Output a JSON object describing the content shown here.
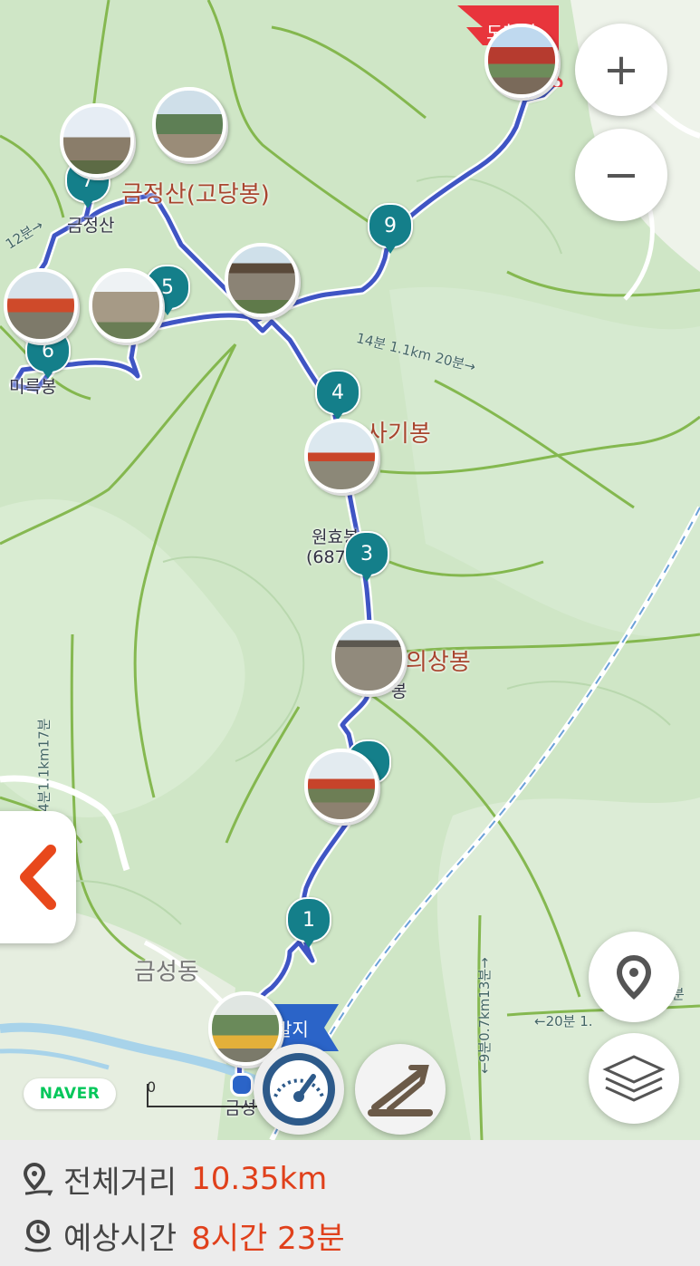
{
  "map": {
    "places": {
      "gojangbong": "금정산(고당봉)",
      "geumjeongsan": "금정산",
      "sagibong": "사기봉",
      "wonhyobong": "원효봉",
      "wonhyobong_elev": "(687",
      "uisangbong": "의상봉",
      "uisangbong_sub": "봉",
      "mireukbong": "미륵봉",
      "geumseongdong": "금성동",
      "bottom_partial": "금성"
    },
    "trail_labels": {
      "t1": "14분 1.1km 20분→",
      "t2": "12분→",
      "t3": "↑4분1.1km17분",
      "t4": "←20분 1.",
      "t5": "←9분0.7km13분→",
      "t6": "분"
    },
    "flags": {
      "start": "출발지",
      "end": "도착지",
      "start_partial": "발지",
      "end_partial": "도착지"
    },
    "waypoints": [
      "1",
      "3",
      "4",
      "6",
      "7",
      "9",
      "5"
    ],
    "zoom_in": "+",
    "zoom_out": "−",
    "naver_badge": "NAVER",
    "scale_zero": "0",
    "icons": [
      "back-chevron-icon",
      "location-pin-icon",
      "layers-icon",
      "speed-gauge-icon",
      "slope-icon",
      "zoom-in-icon",
      "zoom-out-icon",
      "distance-icon",
      "time-icon"
    ],
    "colors": {
      "route": "#3f55c4",
      "pin": "#147f8a",
      "accent": "#e0401b",
      "flag_red": "#e8353c",
      "flag_blue": "#2b64c8"
    }
  },
  "info": {
    "distance_label": "전체거리",
    "distance_value": "10.35km",
    "time_label": "예상시간",
    "time_value": "8시간 23분"
  }
}
